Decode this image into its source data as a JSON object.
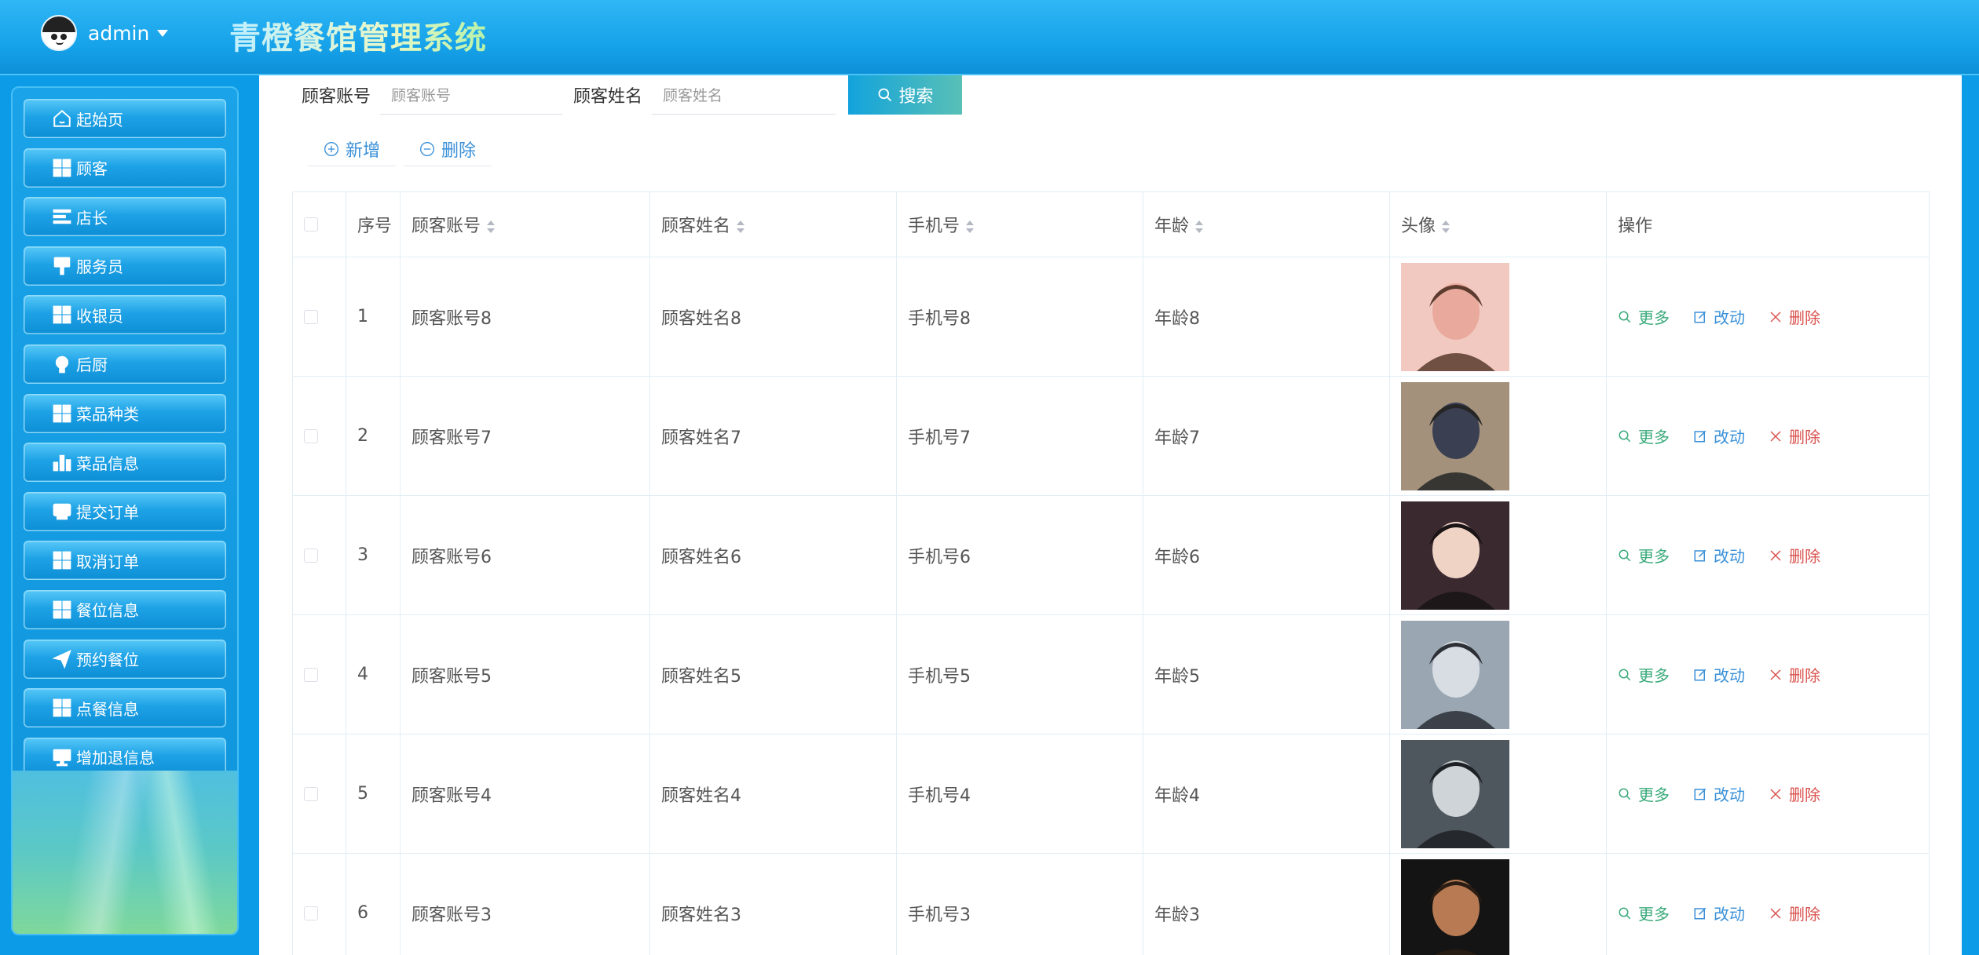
{
  "header": {
    "username": "admin",
    "title": "青橙餐馆管理系统"
  },
  "sidebar": {
    "items": [
      {
        "label": "起始页",
        "icon": "home-icon"
      },
      {
        "label": "顾客",
        "icon": "grid-icon"
      },
      {
        "label": "店长",
        "icon": "list-icon"
      },
      {
        "label": "服务员",
        "icon": "brush-icon"
      },
      {
        "label": "收银员",
        "icon": "grid-icon"
      },
      {
        "label": "后厨",
        "icon": "bulb-icon"
      },
      {
        "label": "菜品种类",
        "icon": "grid-icon"
      },
      {
        "label": "菜品信息",
        "icon": "bar-chart-icon"
      },
      {
        "label": "提交订单",
        "icon": "inbox-icon"
      },
      {
        "label": "取消订单",
        "icon": "grid-icon"
      },
      {
        "label": "餐位信息",
        "icon": "grid-icon"
      },
      {
        "label": "预约餐位",
        "icon": "send-icon"
      },
      {
        "label": "点餐信息",
        "icon": "grid-icon"
      },
      {
        "label": "增加退信息",
        "icon": "monitor-icon"
      }
    ]
  },
  "search": {
    "account_label": "顾客账号",
    "account_placeholder": "顾客账号",
    "name_label": "顾客姓名",
    "name_placeholder": "顾客姓名",
    "button_label": "搜索"
  },
  "actions": {
    "add_label": "新增",
    "delete_label": "删除"
  },
  "table": {
    "columns": [
      "序号",
      "顾客账号",
      "顾客姓名",
      "手机号",
      "年龄",
      "头像",
      "操作"
    ],
    "rows": [
      {
        "index": "1",
        "account": "顾客账号8",
        "name": "顾客姓名8",
        "phone": "手机号8",
        "age": "年龄8"
      },
      {
        "index": "2",
        "account": "顾客账号7",
        "name": "顾客姓名7",
        "phone": "手机号7",
        "age": "年龄7"
      },
      {
        "index": "3",
        "account": "顾客账号6",
        "name": "顾客姓名6",
        "phone": "手机号6",
        "age": "年龄6"
      },
      {
        "index": "4",
        "account": "顾客账号5",
        "name": "顾客姓名5",
        "phone": "手机号5",
        "age": "年龄5"
      },
      {
        "index": "5",
        "account": "顾客账号4",
        "name": "顾客姓名4",
        "phone": "手机号4",
        "age": "年龄4"
      },
      {
        "index": "6",
        "account": "顾客账号3",
        "name": "顾客姓名3",
        "phone": "手机号3",
        "age": "年龄3"
      }
    ],
    "row_actions": {
      "more": "更多",
      "edit": "改动",
      "delete": "删除"
    }
  },
  "colors": {
    "header": "#17a3ea",
    "accent": "#12a3dc",
    "more": "#3aaa7a",
    "edit": "#3a90d8",
    "delete": "#d9534f"
  }
}
